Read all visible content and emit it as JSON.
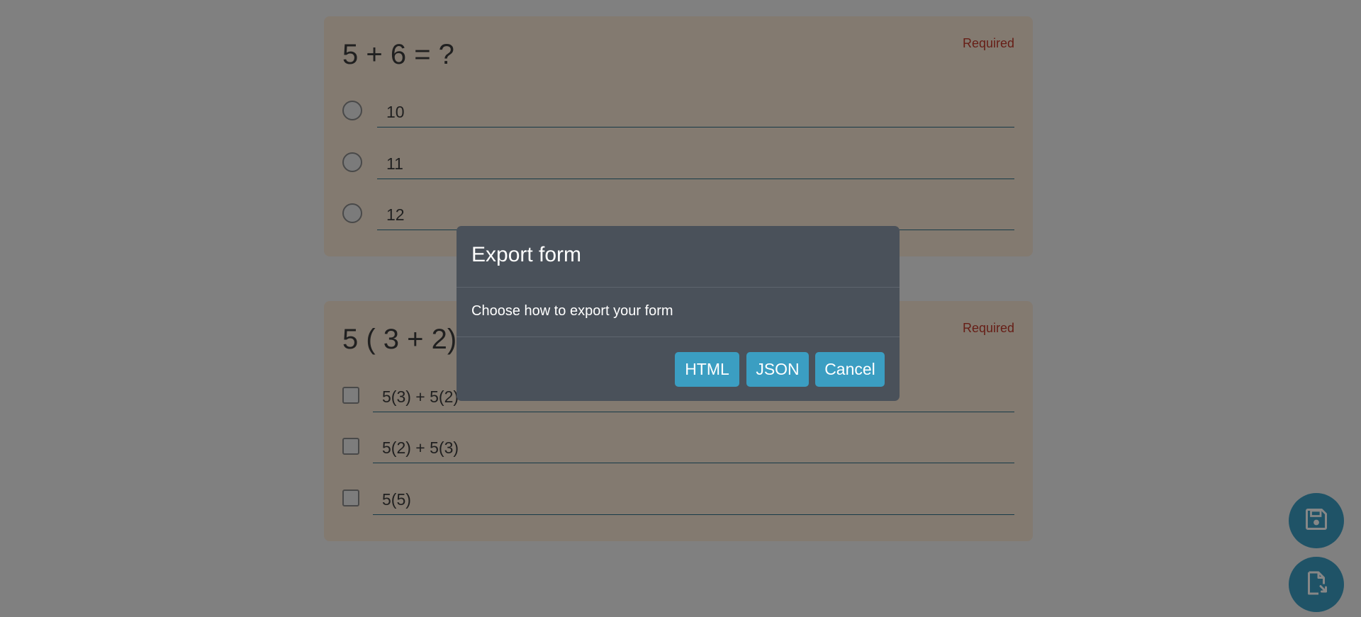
{
  "questions": [
    {
      "title": "5 + 6 = ?",
      "required_label": "Required",
      "type": "radio",
      "options": [
        "10",
        "11",
        "12"
      ]
    },
    {
      "title": "5 ( 3 + 2) =",
      "required_label": "Required",
      "type": "checkbox",
      "options": [
        "5(3) + 5(2)",
        "5(2) + 5(3)",
        "5(5)"
      ]
    }
  ],
  "dialog": {
    "title": "Export form",
    "message": "Choose how to export your form",
    "buttons": {
      "html": "HTML",
      "json": "JSON",
      "cancel": "Cancel"
    }
  },
  "fabs": {
    "save_icon": "floppy-disk-icon",
    "export_icon": "file-export-icon"
  },
  "colors": {
    "accent": "#3b9ec2",
    "card_background": "#f8e7d4",
    "required": "#c0392b",
    "dialog_background": "#4a515a"
  }
}
